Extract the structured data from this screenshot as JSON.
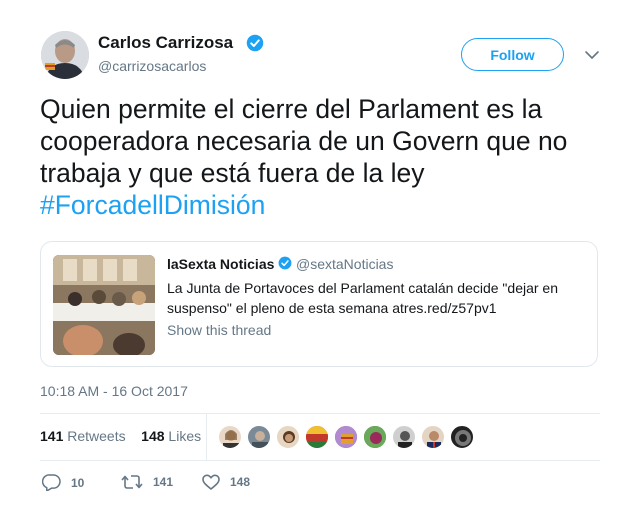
{
  "author": {
    "name": "Carlos Carrizosa",
    "handle": "@carrizosacarlos"
  },
  "follow_label": "Follow",
  "tweet": {
    "text": "Quien permite el cierre del Parlament es la cooperadora necesaria de un Govern que no trabaja y que está fuera de la ley",
    "hashtag": "#ForcadellDimisión"
  },
  "quote": {
    "name": "laSexta Noticias",
    "handle": "@sextaNoticias",
    "text": "La Junta de Portavoces del Parlament catalán decide \"dejar en suspenso\" el pleno de esta semana atres.red/z57pv1",
    "thread_label": "Show this thread"
  },
  "timestamp": "10:18 AM - 16 Oct 2017",
  "stats": {
    "retweets_count": "141",
    "retweets_label": "Retweets",
    "likes_count": "148",
    "likes_label": "Likes"
  },
  "actions": {
    "reply_count": "10",
    "retweet_count": "141",
    "like_count": "148"
  },
  "colors": {
    "accent": "#1da1f2",
    "secondary_text": "#657786",
    "primary_text": "#14171a",
    "border": "#e1e8ed"
  },
  "icons": [
    "verified-badge-icon",
    "chevron-down-icon",
    "reply-icon",
    "retweet-icon",
    "heart-icon"
  ]
}
